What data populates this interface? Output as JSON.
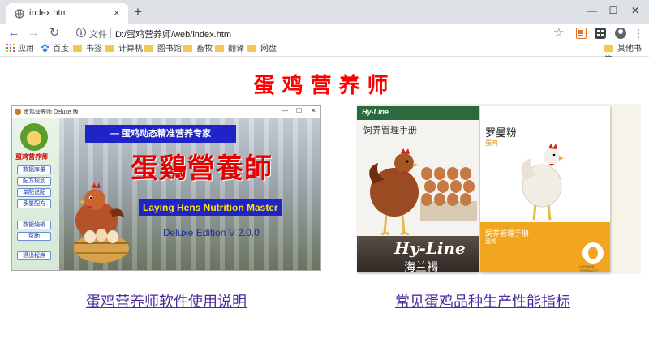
{
  "browser": {
    "tab_title": "index.htm",
    "tab_close": "×",
    "new_tab": "+",
    "window_controls": {
      "minimize": "—",
      "maximize": "☐",
      "close": "✕"
    },
    "scheme_label": "文件",
    "url": "D:/蛋鸡营养师/web/index.htm",
    "back": "←",
    "forward": "→",
    "reload": "↻",
    "star": "☆",
    "menu": "⋮",
    "bookmarks": {
      "apps": "应用",
      "items": [
        "百度",
        "书签",
        "计算机",
        "图书馆",
        "畜牧",
        "翻译",
        "网盘"
      ],
      "other": "其他书签"
    }
  },
  "page": {
    "title": "蛋鸡营养师",
    "software": {
      "window_title": "蛋鸡营养师 Deluxe 版",
      "logo_text": "蛋鸡营养师",
      "menu_buttons": [
        "数据库量",
        "配方规划",
        "单配说配",
        "多量配方",
        "数据编辑",
        "帮助",
        "退出程序"
      ],
      "slogan": "— 蛋鸡动态精准营养专家",
      "big_title": "蛋鷄營養師",
      "english_title": "Laying Hens Nutrition Master",
      "edition": "Deluxe Edition V 2.0.0"
    },
    "books": {
      "book1": {
        "brand": "Hy-Line",
        "title": "饲养管理手册",
        "logo": "Hy-Line",
        "subtitle": "海兰褐"
      },
      "book2": {
        "title": "罗曼粉",
        "subtitle": "蛋鸡",
        "band_title": "饲养管理手册",
        "band_subtitle": "蛋鸡",
        "logo_text": "LOHMANN TIERZUCHT"
      }
    },
    "links": {
      "left": "蛋鸡营养师软件使用说明",
      "right": "常见蛋鸡品种生产性能指标"
    }
  },
  "colors": {
    "title_red": "#ff0000",
    "link_purple": "#4c2a9e",
    "slogan_blue": "#1f24c8",
    "lohmann_orange": "#f2a51e",
    "hyline_green": "#2b6a3e"
  },
  "icons": [
    "globe-icon",
    "info-icon",
    "star-icon",
    "apps-grid-icon",
    "baidu-paw-icon",
    "folder-icon",
    "profile-icon",
    "menu-icon"
  ]
}
